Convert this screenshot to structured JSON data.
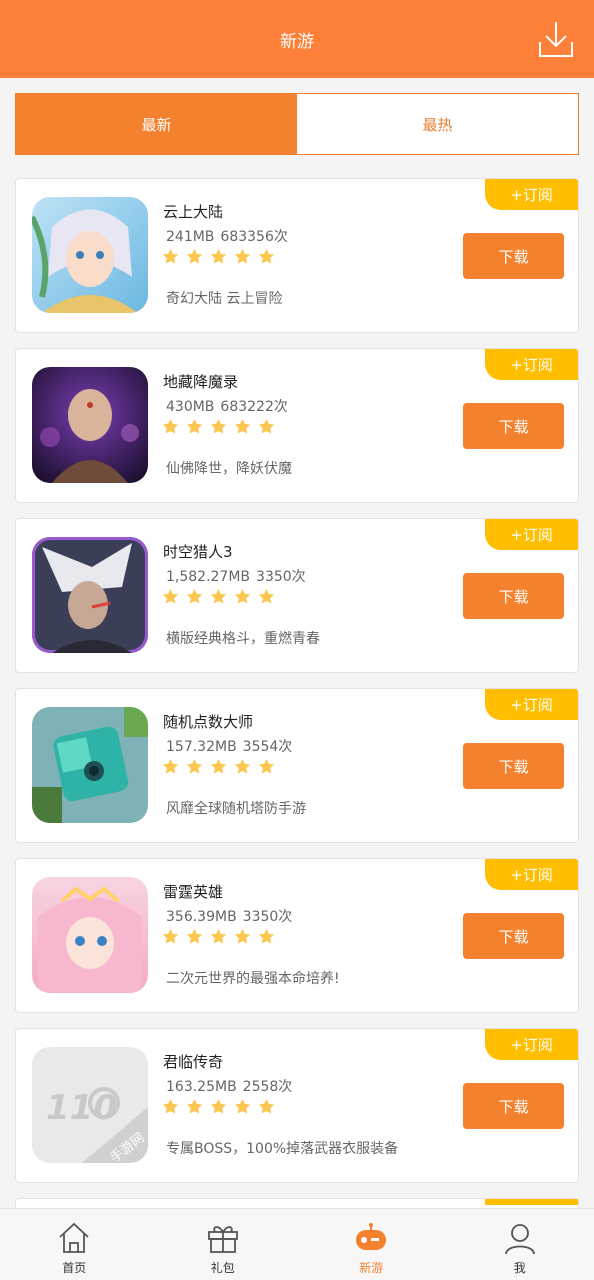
{
  "header": {
    "title": "新游"
  },
  "tabs": [
    {
      "label": "最新",
      "active": true
    },
    {
      "label": "最热",
      "active": false
    }
  ],
  "list_common": {
    "subscribe_label": "+订阅",
    "download_label": "下载"
  },
  "games": [
    {
      "name": "云上大陆",
      "size": "241MB",
      "count": "683356次",
      "stars": 5,
      "desc": "奇幻大陆 云上冒险",
      "icon": "cloud-continent-icon"
    },
    {
      "name": "地藏降魔录",
      "size": "430MB",
      "count": "683222次",
      "stars": 5,
      "desc": "仙佛降世，降妖伏魔",
      "icon": "dizang-icon"
    },
    {
      "name": "时空猎人3",
      "size": "1,582.27MB",
      "count": "3350次",
      "stars": 5,
      "desc": "横版经典格斗，重燃青春",
      "icon": "time-hunter-icon"
    },
    {
      "name": "随机点数大师",
      "size": "157.32MB",
      "count": "3554次",
      "stars": 5,
      "desc": "风靡全球随机塔防手游",
      "icon": "dice-master-icon"
    },
    {
      "name": "雷霆英雄",
      "size": "356.39MB",
      "count": "3350次",
      "stars": 5,
      "desc": "二次元世界的最强本命培养!",
      "icon": "thunder-hero-icon"
    },
    {
      "name": "君临传奇",
      "size": "163.25MB",
      "count": "2558次",
      "stars": 5,
      "desc": "专属BOSS，100%掉落武器衣服装备",
      "icon": "placeholder-logo-icon",
      "icon_text": "110",
      "icon_badge": "手游网"
    }
  ],
  "nav": [
    {
      "label": "首页",
      "icon": "home-icon",
      "active": false
    },
    {
      "label": "礼包",
      "icon": "gift-icon",
      "active": false
    },
    {
      "label": "新游",
      "icon": "new-game-icon",
      "active": true
    },
    {
      "label": "我",
      "icon": "user-icon",
      "active": false
    }
  ],
  "colors": {
    "accent": "#f4812d",
    "header": "#fe7f37",
    "subscribe": "#ffbf00",
    "star": "#fcc64f"
  }
}
